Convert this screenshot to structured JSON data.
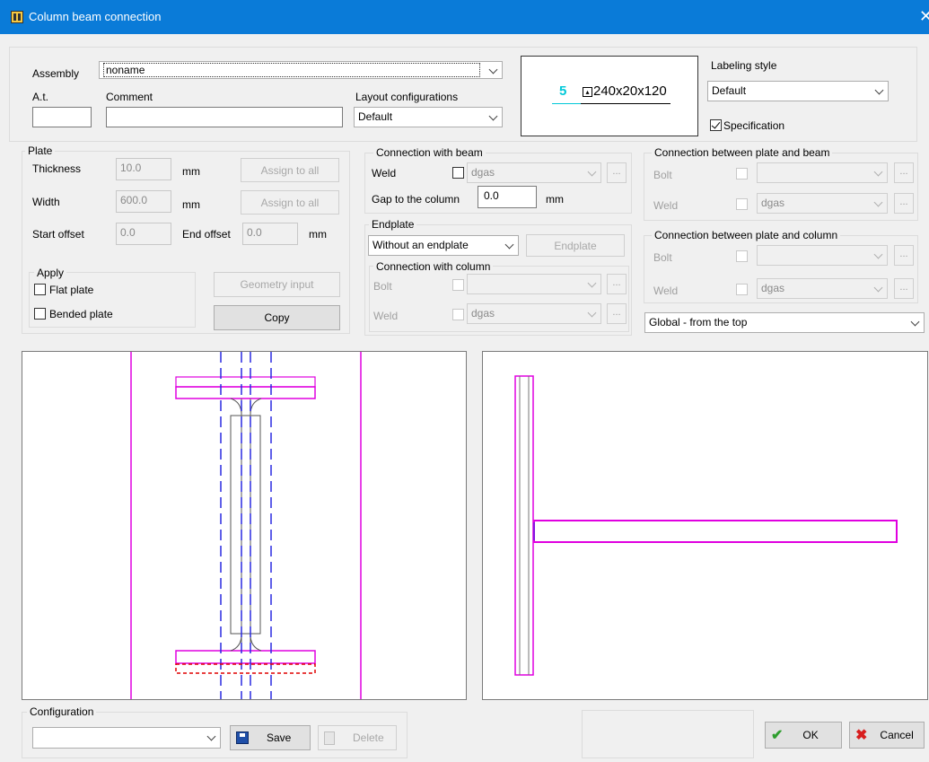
{
  "window": {
    "title": "Column beam connection",
    "close_icon": "close-icon"
  },
  "assembly": {
    "label": "Assembly",
    "value": "noname"
  },
  "at": {
    "label": "A.t.",
    "value": ""
  },
  "comment": {
    "label": "Comment",
    "value": ""
  },
  "layout": {
    "label": "Layout configurations",
    "value": "Default"
  },
  "preview": {
    "count": "5",
    "profile": "240x20x120"
  },
  "labeling": {
    "label": "Labeling style",
    "value": "Default",
    "spec_label": "Specification",
    "spec_checked": true
  },
  "plate": {
    "title": "Plate",
    "thickness_label": "Thickness",
    "thickness_value": "10.0",
    "width_label": "Width",
    "width_value": "600.0",
    "unit": "mm",
    "assign_label": "Assign to all",
    "start_offset_label": "Start offset",
    "start_offset_value": "0.0",
    "end_offset_label": "End offset",
    "end_offset_value": "0.0",
    "apply_title": "Apply",
    "flat_label": "Flat plate",
    "bended_label": "Bended plate",
    "geometry_label": "Geometry input",
    "copy_label": "Copy"
  },
  "beam_conn": {
    "title": "Connection with beam",
    "weld_label": "Weld",
    "weld_value": "dgas",
    "gap_label": "Gap to the column",
    "gap_value": "0.0",
    "unit": "mm"
  },
  "endplate": {
    "title": "Endplate",
    "select_value": "Without an endplate",
    "button_label": "Endplate",
    "col_title": "Connection with column",
    "bolt_label": "Bolt",
    "weld_label": "Weld",
    "weld_value": "dgas"
  },
  "plate_beam": {
    "title": "Connection between plate and beam",
    "bolt_label": "Bolt",
    "weld_label": "Weld",
    "weld_value": "dgas"
  },
  "plate_column": {
    "title": "Connection between plate and column",
    "bolt_label": "Bolt",
    "weld_label": "Weld",
    "weld_value": "dgas"
  },
  "view_select": {
    "value": "Global - from the top"
  },
  "configuration": {
    "title": "Configuration",
    "value": "",
    "save_label": "Save",
    "delete_label": "Delete"
  },
  "footer": {
    "ok_label": "OK",
    "cancel_label": "Cancel"
  },
  "colors": {
    "title_bar": "#0a7bd8",
    "magenta": "#e000e0",
    "blue_dash": "#2a2ae0",
    "red_dash": "#e00000",
    "cyan": "#00c8d8"
  },
  "dots": "..."
}
